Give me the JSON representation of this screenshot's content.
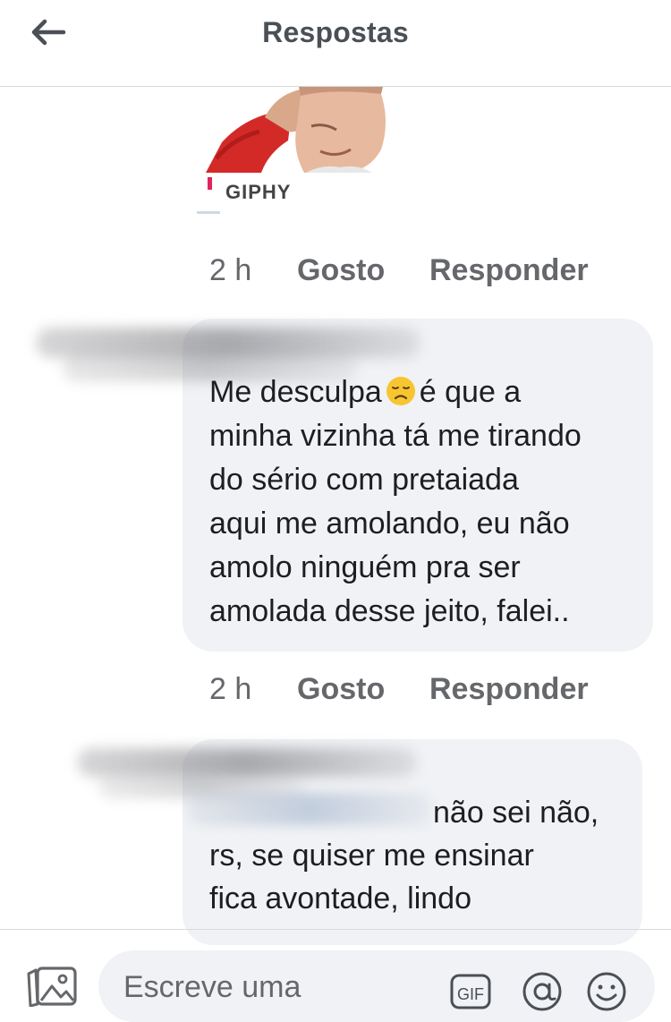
{
  "header": {
    "title": "Respostas",
    "back_icon": "arrow-left-icon"
  },
  "gif": {
    "label": "GIPHY",
    "time": "2 h",
    "like_label": "Gosto",
    "reply_label": "Responder"
  },
  "comments": [
    {
      "lines": [
        "Me desculpa",
        "é que a",
        "minha vizinha tá me tirando",
        "do sério com pretaiada",
        "aqui me amolando, eu não",
        "amolo ninguém pra ser",
        "amolada desse jeito, falei.."
      ],
      "emoji": "disappointed-face-icon",
      "time": "2 h",
      "like_label": "Gosto",
      "reply_label": "Responder"
    },
    {
      "lines": [
        "não sei não,",
        "rs, se quiser me ensinar",
        "fica avontade, lindo"
      ]
    }
  ],
  "composer": {
    "placeholder": "Escreve uma",
    "gif_label": "GIF",
    "icons": [
      "photo-icon",
      "gif-icon",
      "mention-icon",
      "emoji-icon"
    ]
  },
  "colors": {
    "bubble": "#f0f2f5",
    "muted": "#65676b",
    "text": "#1c1e21",
    "title": "#4b4f56"
  }
}
